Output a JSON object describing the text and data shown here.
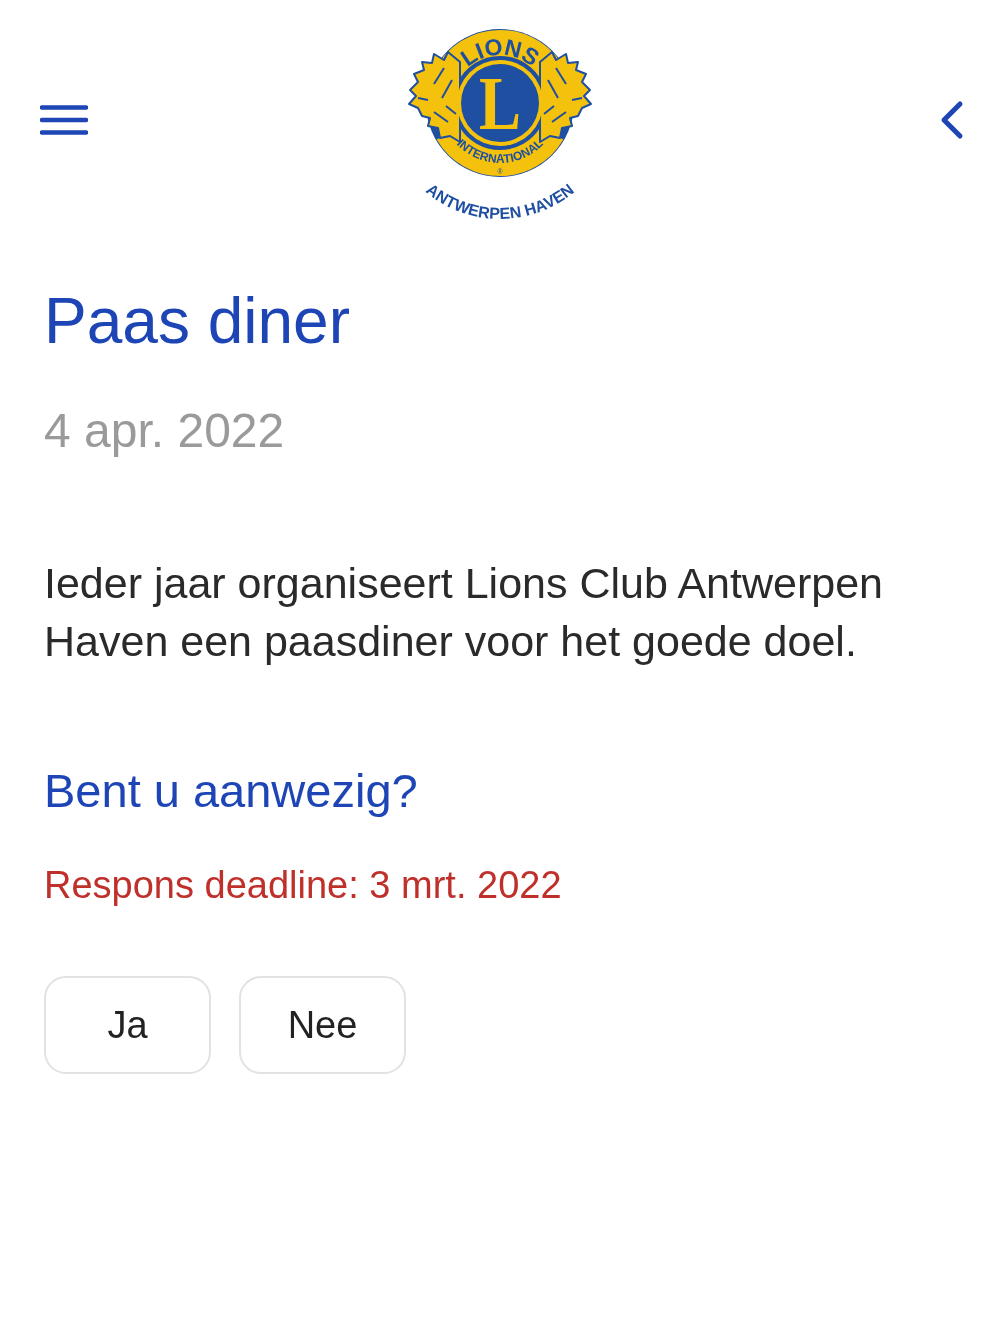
{
  "logo": {
    "top_banner": "LIONS",
    "letter": "L",
    "bottom_banner": "INTERNATIONAL",
    "registered_mark": "®",
    "club_name": "ANTWERPEN HAVEN"
  },
  "event": {
    "title": "Paas diner",
    "date": "4 apr. 2022",
    "description": "Ieder jaar organiseert Lions Club Antwerpen Haven een paasdiner voor het goede doel."
  },
  "rsvp": {
    "question": "Bent u aanwezig?",
    "deadline": "Respons deadline: 3 mrt. 2022",
    "buttons": [
      "Ja",
      "Nee"
    ]
  }
}
